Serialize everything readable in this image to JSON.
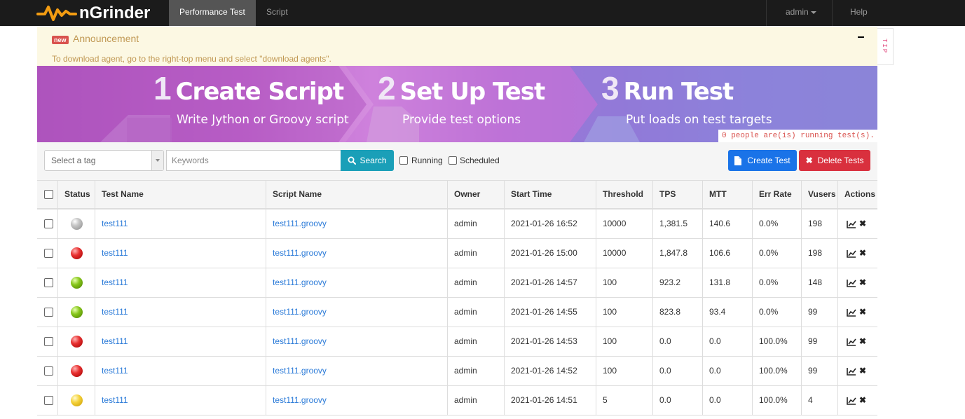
{
  "navbar": {
    "brand": "nGrinder",
    "nav_items": [
      "Performance Test",
      "Script"
    ],
    "user_menu": "admin",
    "help": "Help"
  },
  "announcement": {
    "badge": "new",
    "title": "Announcement",
    "text": "To download agent, go to the right-top menu and select \"download agents\".",
    "tip": "TIP"
  },
  "banner": {
    "steps": [
      {
        "num": "1",
        "title": "Create Script",
        "sub": "Write Jython or Groovy script"
      },
      {
        "num": "2",
        "title": "Set Up Test",
        "sub": "Provide test options"
      },
      {
        "num": "3",
        "title": "Run Test",
        "sub": "Put loads on test targets"
      }
    ],
    "running_note": "0 people are(is) running test(s)."
  },
  "toolbar": {
    "tag_placeholder": "Select a tag",
    "keywords_placeholder": "Keywords",
    "search_label": "Search",
    "running_label": "Running",
    "scheduled_label": "Scheduled",
    "create_label": "Create Test",
    "delete_label": "Delete Tests"
  },
  "table": {
    "headers": [
      "Status",
      "Test Name",
      "Script Name",
      "Owner",
      "Start Time",
      "Threshold",
      "TPS",
      "MTT",
      "Err Rate",
      "Vusers",
      "Actions"
    ],
    "rows": [
      {
        "status": "grey",
        "test_name": "test111",
        "script_name": "test111.groovy",
        "owner": "admin",
        "start_time": "2021-01-26 16:52",
        "threshold": "10000",
        "tps": "1,381.5",
        "mtt": "140.6",
        "err_rate": "0.0%",
        "vusers": "198"
      },
      {
        "status": "red",
        "test_name": "test111",
        "script_name": "test111.groovy",
        "owner": "admin",
        "start_time": "2021-01-26 15:00",
        "threshold": "10000",
        "tps": "1,847.8",
        "mtt": "106.6",
        "err_rate": "0.0%",
        "vusers": "198"
      },
      {
        "status": "green",
        "test_name": "test111",
        "script_name": "test111.groovy",
        "owner": "admin",
        "start_time": "2021-01-26 14:57",
        "threshold": "100",
        "tps": "923.2",
        "mtt": "131.8",
        "err_rate": "0.0%",
        "vusers": "148"
      },
      {
        "status": "green",
        "test_name": "test111",
        "script_name": "test111.groovy",
        "owner": "admin",
        "start_time": "2021-01-26 14:55",
        "threshold": "100",
        "tps": "823.8",
        "mtt": "93.4",
        "err_rate": "0.0%",
        "vusers": "99"
      },
      {
        "status": "red",
        "test_name": "test111",
        "script_name": "test111.groovy",
        "owner": "admin",
        "start_time": "2021-01-26 14:53",
        "threshold": "100",
        "tps": "0.0",
        "mtt": "0.0",
        "err_rate": "100.0%",
        "vusers": "99"
      },
      {
        "status": "red",
        "test_name": "test111",
        "script_name": "test111.groovy",
        "owner": "admin",
        "start_time": "2021-01-26 14:52",
        "threshold": "100",
        "tps": "0.0",
        "mtt": "0.0",
        "err_rate": "100.0%",
        "vusers": "99"
      },
      {
        "status": "yellow",
        "test_name": "test111",
        "script_name": "test111.groovy",
        "owner": "admin",
        "start_time": "2021-01-26 14:51",
        "threshold": "5",
        "tps": "0.0",
        "mtt": "0.0",
        "err_rate": "100.0%",
        "vusers": "4"
      }
    ]
  },
  "colors": {
    "accent": "#1a9fb8",
    "create": "#1a73e8",
    "delete": "#d9303e",
    "link": "#2a7ad8"
  }
}
